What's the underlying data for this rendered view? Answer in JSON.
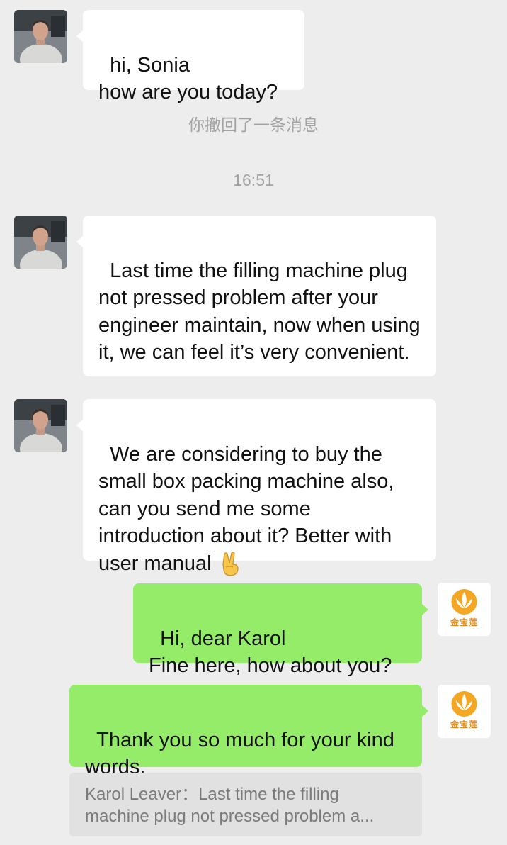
{
  "messages": [
    {
      "sender": "contact",
      "text": "hi, Sonia\nhow are you today?"
    },
    {
      "sender": "contact",
      "text": "Last time the filling machine plug not pressed problem after your engineer maintain, now when using it, we can feel it’s very convenient."
    },
    {
      "sender": "contact",
      "text": "We are considering to buy the small box packing machine also, can you send me some introduction about it? Better with user manual",
      "emoji": "victory-hand-icon"
    },
    {
      "sender": "me",
      "text": "Hi, dear Karol\nFine here, how about you?"
    },
    {
      "sender": "me",
      "text": "Thank you so much for your kind words."
    }
  ],
  "system": {
    "recall_notice": "你撤回了一条消息",
    "timestamp": "16:51"
  },
  "quote": {
    "text": "Karol Leaver：Last time the filling machine plug not pressed problem a..."
  },
  "my_avatar": {
    "brand_text": "金宝莲",
    "brand_color": "#ee8a16"
  },
  "colors": {
    "background": "#ededed",
    "incoming_bubble": "#ffffff",
    "outgoing_bubble": "#95ec69",
    "system_text": "#a3a3a3"
  }
}
